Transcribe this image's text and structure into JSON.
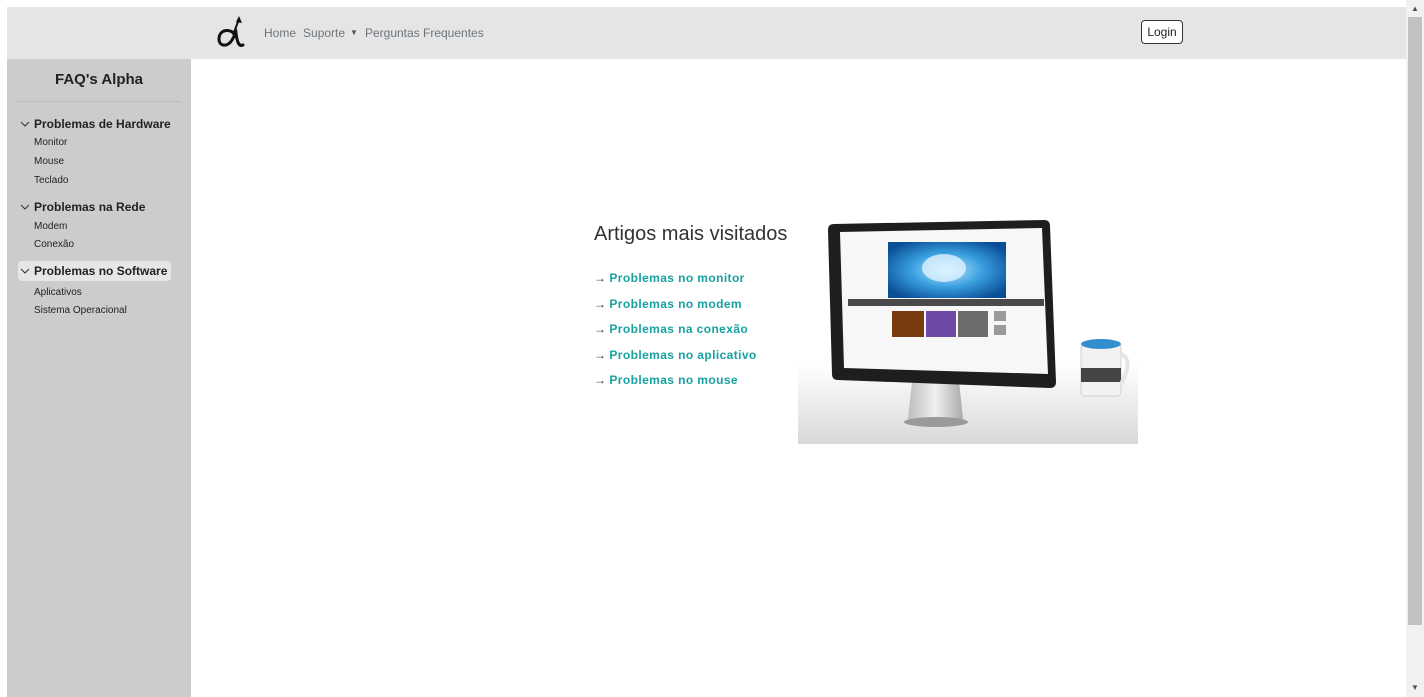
{
  "navbar": {
    "links": [
      {
        "label": "Home"
      },
      {
        "label": "Suporte"
      },
      {
        "label": "Perguntas Frequentes"
      }
    ],
    "login_label": "Login"
  },
  "sidebar": {
    "title": "FAQ's Alpha",
    "groups": [
      {
        "label": "Problemas de Hardware",
        "items": [
          "Monitor",
          "Mouse",
          "Teclado"
        ]
      },
      {
        "label": "Problemas na Rede",
        "items": [
          "Modem",
          "Conexão"
        ]
      },
      {
        "label": "Problemas no Software",
        "items": [
          "Aplicativos",
          "Sistema Operacional"
        ]
      }
    ]
  },
  "main": {
    "title": "Artigos mais visitados",
    "arrow": "→",
    "articles": [
      "Problemas no monitor",
      "Problemas no modem",
      "Problemas na conexão",
      "Problemas no aplicativo",
      "Problemas no mouse"
    ]
  },
  "colors": {
    "navbar_bg": "#e5e5e5",
    "sidebar_bg": "#cccccc",
    "link_accent": "#17a2a0"
  },
  "icons": [
    "alpha-logo-icon",
    "caret-down-icon",
    "chevron-down-icon",
    "arrow-right-icon",
    "scroll-up-icon",
    "scroll-down-icon"
  ]
}
